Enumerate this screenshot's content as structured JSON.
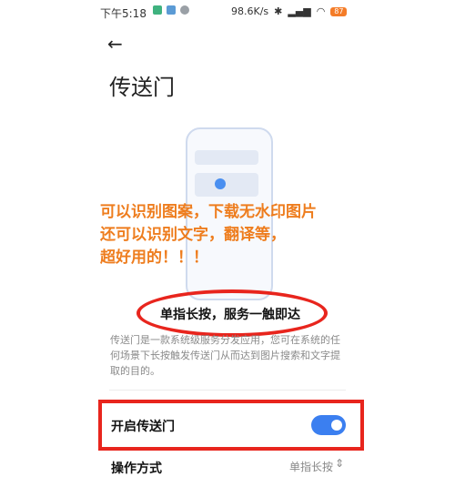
{
  "status": {
    "time": "下午5:18",
    "speed": "98.6K/s",
    "battery": "87"
  },
  "page": {
    "title": "传送门",
    "back_glyph": "←"
  },
  "overlay": {
    "line1": "可以识别图案，下载无水印图片",
    "line2": "还可以识别文字，翻译等，",
    "line3": "超好用的！！！"
  },
  "feature": {
    "headline": "单指长按，服务一触即达",
    "description": "传送门是一款系统级服务分发应用，您可在系统的任何场景下长按触发传送门从而达到图片搜索和文字提取的目的。"
  },
  "settings": {
    "enable_label": "开启传送门",
    "enable_on": true,
    "operation_label": "操作方式",
    "operation_value": "单指长按"
  },
  "colors": {
    "accent": "#3b7ff0",
    "annotation_red": "#e8251d",
    "annotation_orange": "#ee7d1e"
  }
}
